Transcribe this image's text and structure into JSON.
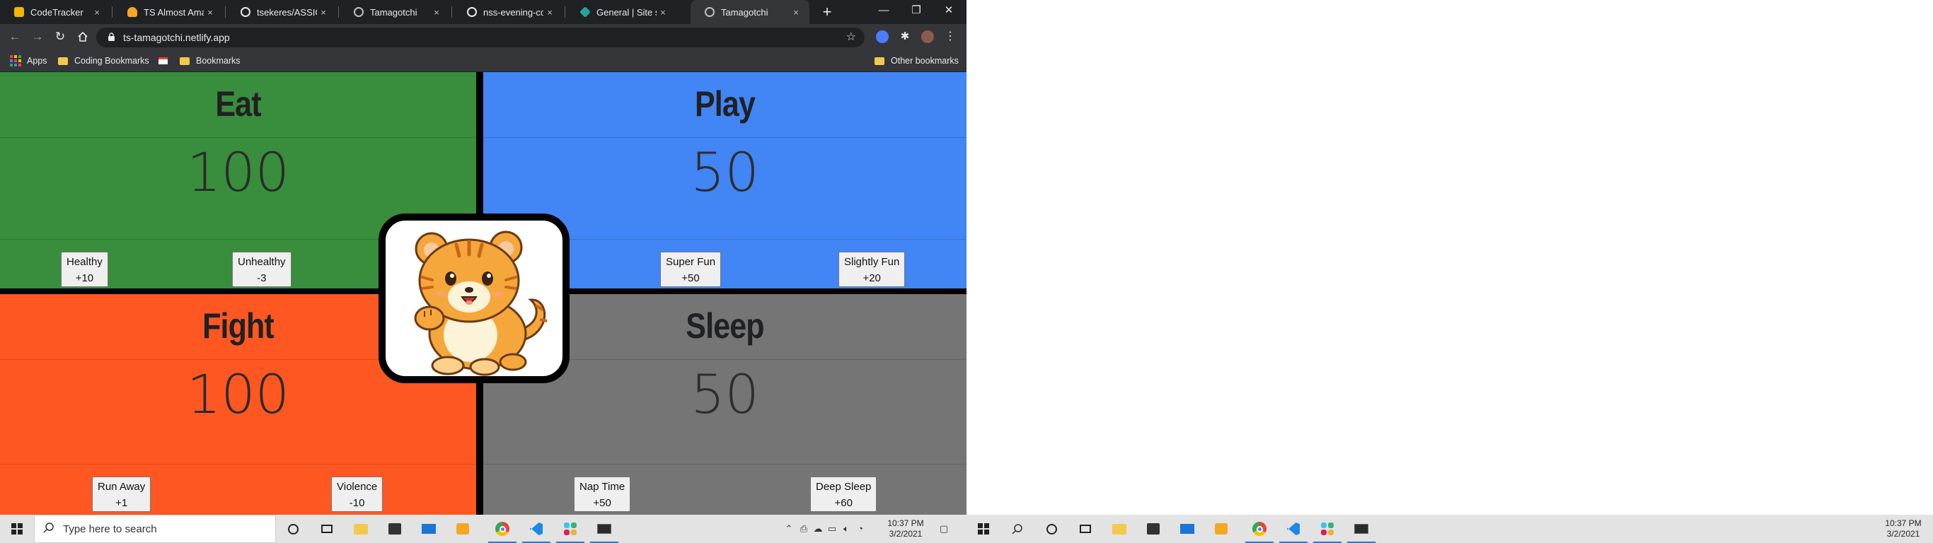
{
  "browser": {
    "tabs": [
      {
        "title": "CodeTracker",
        "favicon_color": "#f4b400",
        "active": false
      },
      {
        "title": "TS Almost Amazon",
        "favicon_color": "#f5a623",
        "active": false
      },
      {
        "title": "tsekeres/ASSIGNM",
        "favicon_color": "#ffffff",
        "active": false
      },
      {
        "title": "Tamagotchi",
        "favicon_color": "#bdc1c6",
        "active": false
      },
      {
        "title": "nss-evening-coho",
        "favicon_color": "#ffffff",
        "active": false
      },
      {
        "title": "General | Site setti",
        "favicon_color": "#26a69a",
        "active": false
      },
      {
        "title": "Tamagotchi",
        "favicon_color": "#bdc1c6",
        "active": true
      }
    ],
    "tab_close_glyph": "×",
    "new_tab_glyph": "+",
    "window_controls": {
      "minimize": "—",
      "restore": "❐",
      "close": "✕"
    },
    "url": "ts-tamagotchi.netlify.app",
    "bookmarks": {
      "apps": "Apps",
      "coding": "Coding Bookmarks",
      "bookmarks": "Bookmarks",
      "other": "Other bookmarks"
    }
  },
  "tamagotchi": {
    "eat": {
      "title": "Eat",
      "value": "100",
      "color": "#388e3c",
      "buttons": [
        {
          "name": "Healthy",
          "delta": "+10"
        },
        {
          "name": "Unhealthy",
          "delta": "-3"
        }
      ]
    },
    "play": {
      "title": "Play",
      "value": "50",
      "color": "#4285f4",
      "buttons": [
        {
          "name": "Super Fun",
          "delta": "+50"
        },
        {
          "name": "Slightly Fun",
          "delta": "+20"
        }
      ]
    },
    "fight": {
      "title": "Fight",
      "value": "100",
      "color": "#ff5722",
      "buttons": [
        {
          "name": "Run Away",
          "delta": "+1"
        },
        {
          "name": "Violence",
          "delta": "-10"
        }
      ]
    },
    "sleep": {
      "title": "Sleep",
      "value": "50",
      "color": "#757575",
      "buttons": [
        {
          "name": "Nap Time",
          "delta": "+50"
        },
        {
          "name": "Deep Sleep",
          "delta": "+60"
        }
      ]
    }
  },
  "taskbar": {
    "search_placeholder": "Type here to search",
    "clock_time": "10:37 PM",
    "clock_date": "3/2/2021"
  },
  "taskbar_right": {
    "clock_time": "10:37 PM",
    "clock_date": "3/2/2021"
  }
}
